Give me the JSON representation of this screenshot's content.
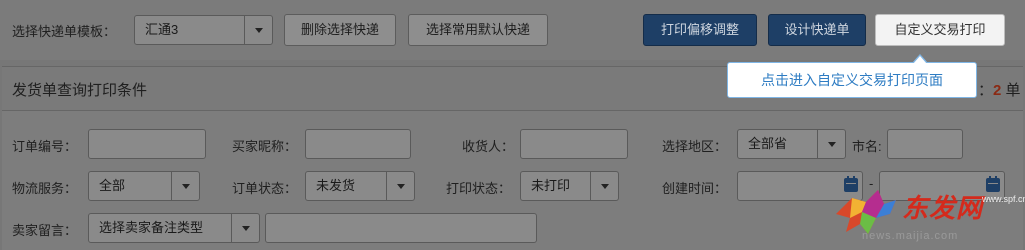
{
  "toolbar": {
    "template_label": "选择快递单模板：",
    "template_value": "汇通3",
    "delete_button": "删除选择快递",
    "default_button": "选择常用默认快递",
    "offset_button": "打印偏移调整",
    "design_button": "设计快递单",
    "custom_print_button": "自定义交易打印"
  },
  "tooltip": {
    "text": "点击进入自定义交易打印页面"
  },
  "panel": {
    "title": "发货单查询打印条件",
    "count_prefix": "：",
    "count_value": "2",
    "count_unit": "单"
  },
  "filters": {
    "order_no_label": "订单编号：",
    "order_no_value": "",
    "buyer_nick_label": "买家昵称：",
    "buyer_nick_value": "",
    "receiver_label": "收货人：",
    "receiver_value": "",
    "region_label": "选择地区：",
    "region_value": "全部省",
    "city_label": "市名:",
    "city_value": "",
    "logistics_label": "物流服务：",
    "logistics_value": "全部",
    "order_status_label": "订单状态：",
    "order_status_value": "未发货",
    "print_status_label": "打印状态：",
    "print_status_value": "未打印",
    "created_label": "创建时间：",
    "created_from": "",
    "created_dash": "-",
    "created_to": "",
    "seller_note_label": "卖家留言：",
    "seller_note_type": "选择卖家备注类型",
    "seller_note_value": ""
  },
  "watermark": {
    "brand": "东发网",
    "url": "news.maijia.com",
    "small": "www.spf.cn"
  },
  "colors": {
    "primary_button": "#1e3f66",
    "tooltip_text": "#2e7cc3",
    "count_highlight": "#8a2a14",
    "watermark": "#d42a1c"
  }
}
